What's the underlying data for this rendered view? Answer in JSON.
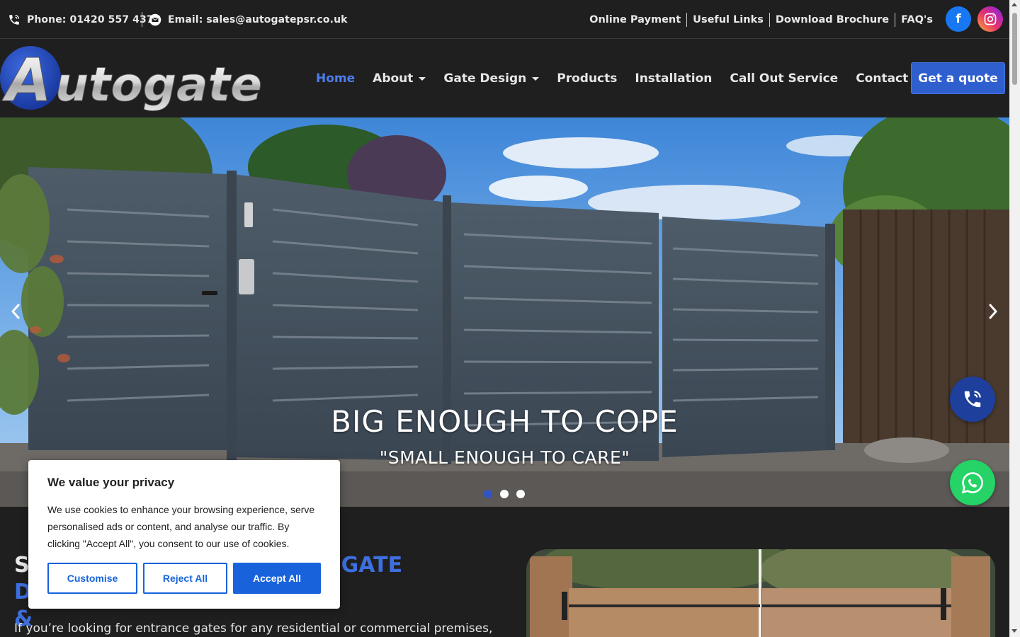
{
  "topbar": {
    "phone": "Phone: 01420 557 437",
    "email": "Email: sales@autogatepsr.co.uk",
    "links": [
      "Online Payment",
      "Useful Links",
      "Download Brochure",
      "FAQ's"
    ],
    "social": [
      "facebook-icon",
      "instagram-icon"
    ]
  },
  "header": {
    "logo_text": "Autogate",
    "nav": [
      {
        "label": "Home",
        "active": true
      },
      {
        "label": "About",
        "dropdown": true
      },
      {
        "label": "Gate Design",
        "dropdown": true
      },
      {
        "label": "Products"
      },
      {
        "label": "Installation"
      },
      {
        "label": "Call Out Service"
      },
      {
        "label": "Contact"
      }
    ],
    "cta": "Get a quote"
  },
  "hero": {
    "title": "BIG ENOUGH TO COPE",
    "subtitle": "\"SMALL ENOUGH TO CARE\"",
    "slides": 3,
    "active_slide": 1
  },
  "content": {
    "heading_start": "S",
    "heading_blue": "GATE DESIGN",
    "heading_line2": "&",
    "text": "If you’re looking for entrance gates for any residential or commercial premises,"
  },
  "cookie": {
    "title": "We value your privacy",
    "text": "We use cookies to enhance your browsing experience, serve personalised ads or content, and analyse our traffic. By clicking \"Accept All\", you consent to our use of cookies.",
    "customise": "Customise",
    "reject": "Reject All",
    "accept": "Accept All"
  },
  "colors": {
    "accent": "#3d6fe0",
    "cta": "#2f5fcf",
    "whatsapp": "#25d366",
    "cookie_button": "#1863dc"
  }
}
